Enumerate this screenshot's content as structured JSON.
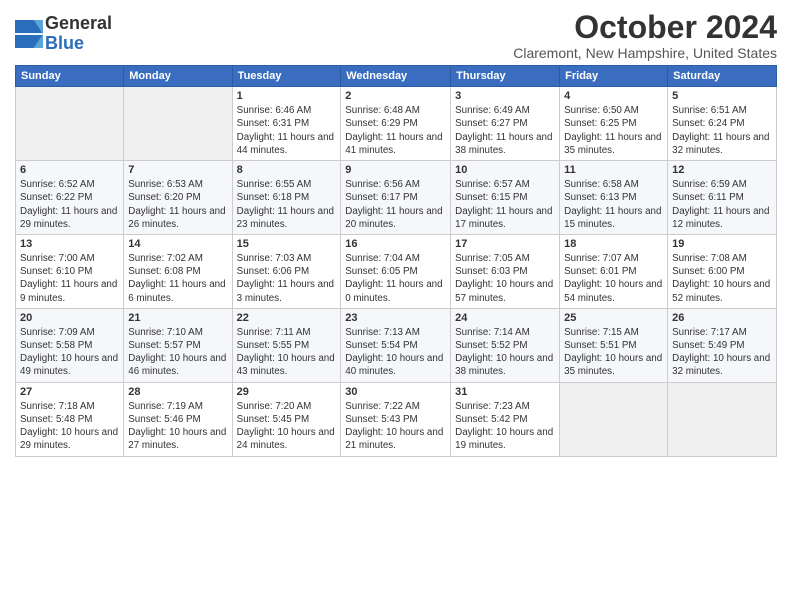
{
  "header": {
    "logo_line1": "General",
    "logo_line2": "Blue",
    "month": "October 2024",
    "location": "Claremont, New Hampshire, United States"
  },
  "weekdays": [
    "Sunday",
    "Monday",
    "Tuesday",
    "Wednesday",
    "Thursday",
    "Friday",
    "Saturday"
  ],
  "weeks": [
    [
      {
        "day": "",
        "info": ""
      },
      {
        "day": "",
        "info": ""
      },
      {
        "day": "1",
        "info": "Sunrise: 6:46 AM\nSunset: 6:31 PM\nDaylight: 11 hours and 44 minutes."
      },
      {
        "day": "2",
        "info": "Sunrise: 6:48 AM\nSunset: 6:29 PM\nDaylight: 11 hours and 41 minutes."
      },
      {
        "day": "3",
        "info": "Sunrise: 6:49 AM\nSunset: 6:27 PM\nDaylight: 11 hours and 38 minutes."
      },
      {
        "day": "4",
        "info": "Sunrise: 6:50 AM\nSunset: 6:25 PM\nDaylight: 11 hours and 35 minutes."
      },
      {
        "day": "5",
        "info": "Sunrise: 6:51 AM\nSunset: 6:24 PM\nDaylight: 11 hours and 32 minutes."
      }
    ],
    [
      {
        "day": "6",
        "info": "Sunrise: 6:52 AM\nSunset: 6:22 PM\nDaylight: 11 hours and 29 minutes."
      },
      {
        "day": "7",
        "info": "Sunrise: 6:53 AM\nSunset: 6:20 PM\nDaylight: 11 hours and 26 minutes."
      },
      {
        "day": "8",
        "info": "Sunrise: 6:55 AM\nSunset: 6:18 PM\nDaylight: 11 hours and 23 minutes."
      },
      {
        "day": "9",
        "info": "Sunrise: 6:56 AM\nSunset: 6:17 PM\nDaylight: 11 hours and 20 minutes."
      },
      {
        "day": "10",
        "info": "Sunrise: 6:57 AM\nSunset: 6:15 PM\nDaylight: 11 hours and 17 minutes."
      },
      {
        "day": "11",
        "info": "Sunrise: 6:58 AM\nSunset: 6:13 PM\nDaylight: 11 hours and 15 minutes."
      },
      {
        "day": "12",
        "info": "Sunrise: 6:59 AM\nSunset: 6:11 PM\nDaylight: 11 hours and 12 minutes."
      }
    ],
    [
      {
        "day": "13",
        "info": "Sunrise: 7:00 AM\nSunset: 6:10 PM\nDaylight: 11 hours and 9 minutes."
      },
      {
        "day": "14",
        "info": "Sunrise: 7:02 AM\nSunset: 6:08 PM\nDaylight: 11 hours and 6 minutes."
      },
      {
        "day": "15",
        "info": "Sunrise: 7:03 AM\nSunset: 6:06 PM\nDaylight: 11 hours and 3 minutes."
      },
      {
        "day": "16",
        "info": "Sunrise: 7:04 AM\nSunset: 6:05 PM\nDaylight: 11 hours and 0 minutes."
      },
      {
        "day": "17",
        "info": "Sunrise: 7:05 AM\nSunset: 6:03 PM\nDaylight: 10 hours and 57 minutes."
      },
      {
        "day": "18",
        "info": "Sunrise: 7:07 AM\nSunset: 6:01 PM\nDaylight: 10 hours and 54 minutes."
      },
      {
        "day": "19",
        "info": "Sunrise: 7:08 AM\nSunset: 6:00 PM\nDaylight: 10 hours and 52 minutes."
      }
    ],
    [
      {
        "day": "20",
        "info": "Sunrise: 7:09 AM\nSunset: 5:58 PM\nDaylight: 10 hours and 49 minutes."
      },
      {
        "day": "21",
        "info": "Sunrise: 7:10 AM\nSunset: 5:57 PM\nDaylight: 10 hours and 46 minutes."
      },
      {
        "day": "22",
        "info": "Sunrise: 7:11 AM\nSunset: 5:55 PM\nDaylight: 10 hours and 43 minutes."
      },
      {
        "day": "23",
        "info": "Sunrise: 7:13 AM\nSunset: 5:54 PM\nDaylight: 10 hours and 40 minutes."
      },
      {
        "day": "24",
        "info": "Sunrise: 7:14 AM\nSunset: 5:52 PM\nDaylight: 10 hours and 38 minutes."
      },
      {
        "day": "25",
        "info": "Sunrise: 7:15 AM\nSunset: 5:51 PM\nDaylight: 10 hours and 35 minutes."
      },
      {
        "day": "26",
        "info": "Sunrise: 7:17 AM\nSunset: 5:49 PM\nDaylight: 10 hours and 32 minutes."
      }
    ],
    [
      {
        "day": "27",
        "info": "Sunrise: 7:18 AM\nSunset: 5:48 PM\nDaylight: 10 hours and 29 minutes."
      },
      {
        "day": "28",
        "info": "Sunrise: 7:19 AM\nSunset: 5:46 PM\nDaylight: 10 hours and 27 minutes."
      },
      {
        "day": "29",
        "info": "Sunrise: 7:20 AM\nSunset: 5:45 PM\nDaylight: 10 hours and 24 minutes."
      },
      {
        "day": "30",
        "info": "Sunrise: 7:22 AM\nSunset: 5:43 PM\nDaylight: 10 hours and 21 minutes."
      },
      {
        "day": "31",
        "info": "Sunrise: 7:23 AM\nSunset: 5:42 PM\nDaylight: 10 hours and 19 minutes."
      },
      {
        "day": "",
        "info": ""
      },
      {
        "day": "",
        "info": ""
      }
    ]
  ]
}
